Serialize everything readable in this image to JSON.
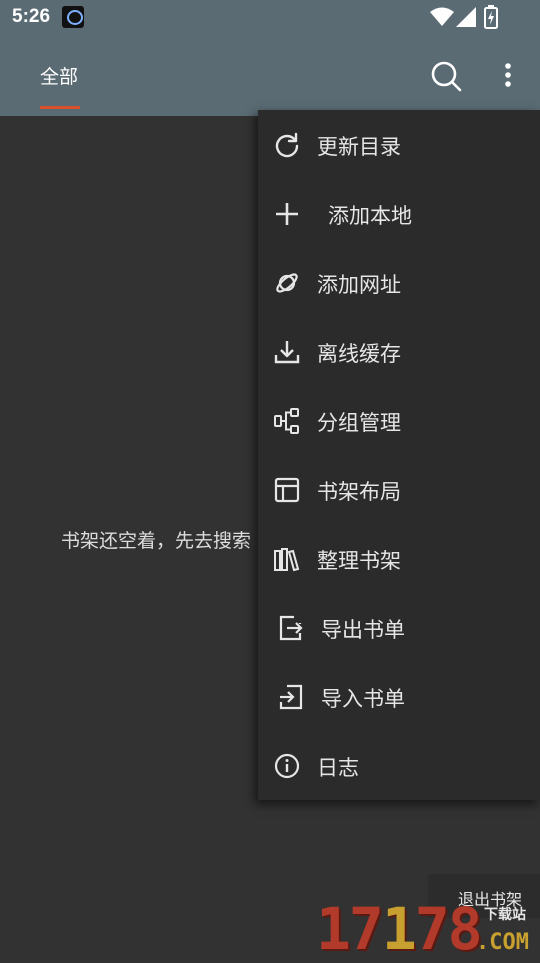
{
  "status_bar": {
    "time": "5:26"
  },
  "toolbar": {
    "tab_all": "全部"
  },
  "main": {
    "empty_message": "书架还空着，先去搜索"
  },
  "menu": {
    "items": [
      {
        "label": "更新目录",
        "icon": "refresh-icon"
      },
      {
        "label": "添加本地",
        "icon": "plus-icon"
      },
      {
        "label": "添加网址",
        "icon": "planet-icon"
      },
      {
        "label": "离线缓存",
        "icon": "download-icon"
      },
      {
        "label": "分组管理",
        "icon": "group-icon"
      },
      {
        "label": "书架布局",
        "icon": "layout-icon"
      },
      {
        "label": "整理书架",
        "icon": "books-icon"
      },
      {
        "label": "导出书单",
        "icon": "export-icon"
      },
      {
        "label": "导入书单",
        "icon": "import-icon"
      },
      {
        "label": "日志",
        "icon": "info-icon"
      }
    ]
  },
  "bottom": {
    "exit_label": "退出书架"
  },
  "watermark": {
    "number": "17178",
    "sub": "下载站",
    "domain": ".COM"
  },
  "colors": {
    "appbar": "#5a6b73",
    "background": "#323232",
    "menu": "#2b2b2b",
    "accent": "#d9502a"
  }
}
